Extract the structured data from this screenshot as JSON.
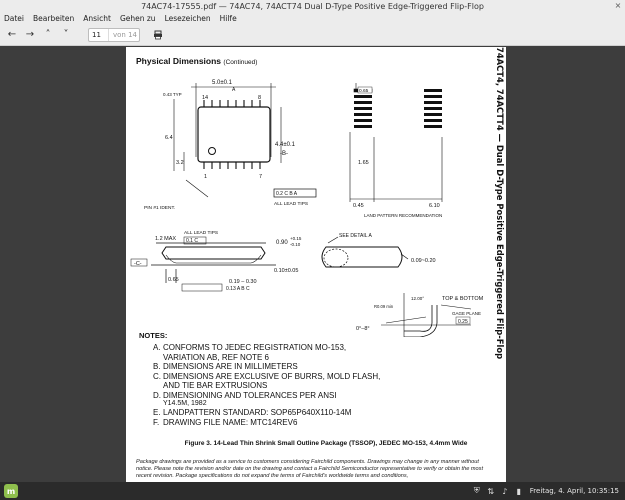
{
  "window": {
    "title": "74AC74-17555.pdf — 74AC74, 74ACT74 Dual D-Type Positive Edge-Triggered Flip-Flop",
    "close_glyph": "×"
  },
  "menu": [
    "Datei",
    "Bearbeiten",
    "Ansicht",
    "Gehen zu",
    "Lesezeichen",
    "Hilfe"
  ],
  "toolbar": {
    "page_current": "11",
    "page_total": "von 14"
  },
  "document": {
    "side_title": "74ACT4, 74ACTT4 — Dual D-Type Positive Edge-Triggered Flip-Flop",
    "heading": "Physical Dimensions",
    "heading_suffix": "(Continued)",
    "drawing": {
      "top_width": "5.0±0.1",
      "typ": "0.43 TYP",
      "pin14": "14",
      "pin8": "8",
      "pin1": "1",
      "pin7": "7",
      "left_64": "6.4",
      "left_32": "3.2",
      "body_w": "4.4±0.1",
      "datum_b": "-B-",
      "datum_a": "A",
      "tol_box": "0.2 C B A",
      "all_lead_tips_1": "ALL LEAD TIPS",
      "pin1_ident": "PIN #1 IDENT.",
      "lp_065": "0.65",
      "lp_165": "1.65",
      "lp_045": "0.45",
      "lp_610": "6.10",
      "lp_label": "LAND PATTERN RECOMMENDATION",
      "max_12": "1.2 MAX",
      "all_lead_tips_2": "ALL LEAD TIPS",
      "tol_01": "0.1 C",
      "angle": "0.90",
      "angle_tol_p": "+0.15",
      "angle_tol_m": "-0.10",
      "datum_c": "-C-",
      "p065": "0.65",
      "p010": "0.10±0.05",
      "p019": "0.19 – 0.30",
      "p013": "0.13 A B C",
      "see_detail": "SEE DETAIL A",
      "r009": "0.09~0.20",
      "r_top": "12.00°",
      "top_bottom": "TOP & BOTTOM",
      "r009min": "R0.09 min",
      "gage_plane": "GAGE PLANE",
      "p025": "0.25",
      "ang08": "0°–8°",
      "p06": "0.6±0.1",
      "seating_plane": "SEATING PLANE",
      "r009min2": "R0.09min",
      "p100": "1.00",
      "detail_a": "DETAIL A"
    },
    "notes": {
      "heading": "NOTES:",
      "items": [
        {
          "letter": "A.",
          "text": "CONFORMS TO JEDEC REGISTRATION MO-153,\nVARIATION AB, REF NOTE 6"
        },
        {
          "letter": "B.",
          "text": "DIMENSIONS ARE IN MILLIMETERS"
        },
        {
          "letter": "C.",
          "text": "DIMENSIONS ARE EXCLUSIVE OF BURRS, MOLD FLASH,\nAND TIE BAR EXTRUSIONS"
        },
        {
          "letter": "D.",
          "text": "DIMENSIONING AND TOLERANCES PER ANSI",
          "sub": "Y14.5M, 1982"
        },
        {
          "letter": "E.",
          "text": "LANDPATTERN STANDARD: SOP65P640X110-14M"
        },
        {
          "letter": "F.",
          "text": "DRAWING FILE NAME: MTC14REV6"
        }
      ]
    },
    "caption": "Figure 3. 14-Lead Thin Shrink Small Outline Package (TSSOP), JEDEC MO-153, 4.4mm Wide",
    "disclaimer": "Package drawings are provided as a service to customers considering Fairchild components. Drawings may change in any manner without notice. Please note the revision and/or date on the drawing and contact a Fairchild Semiconductor representative to verify or obtain the most recent revision. Package specifications do not expand the terms of Fairchild's worldwide terms and conditions,"
  },
  "taskbar": {
    "clock": "Freitag, 4. April, 10:35:15"
  }
}
